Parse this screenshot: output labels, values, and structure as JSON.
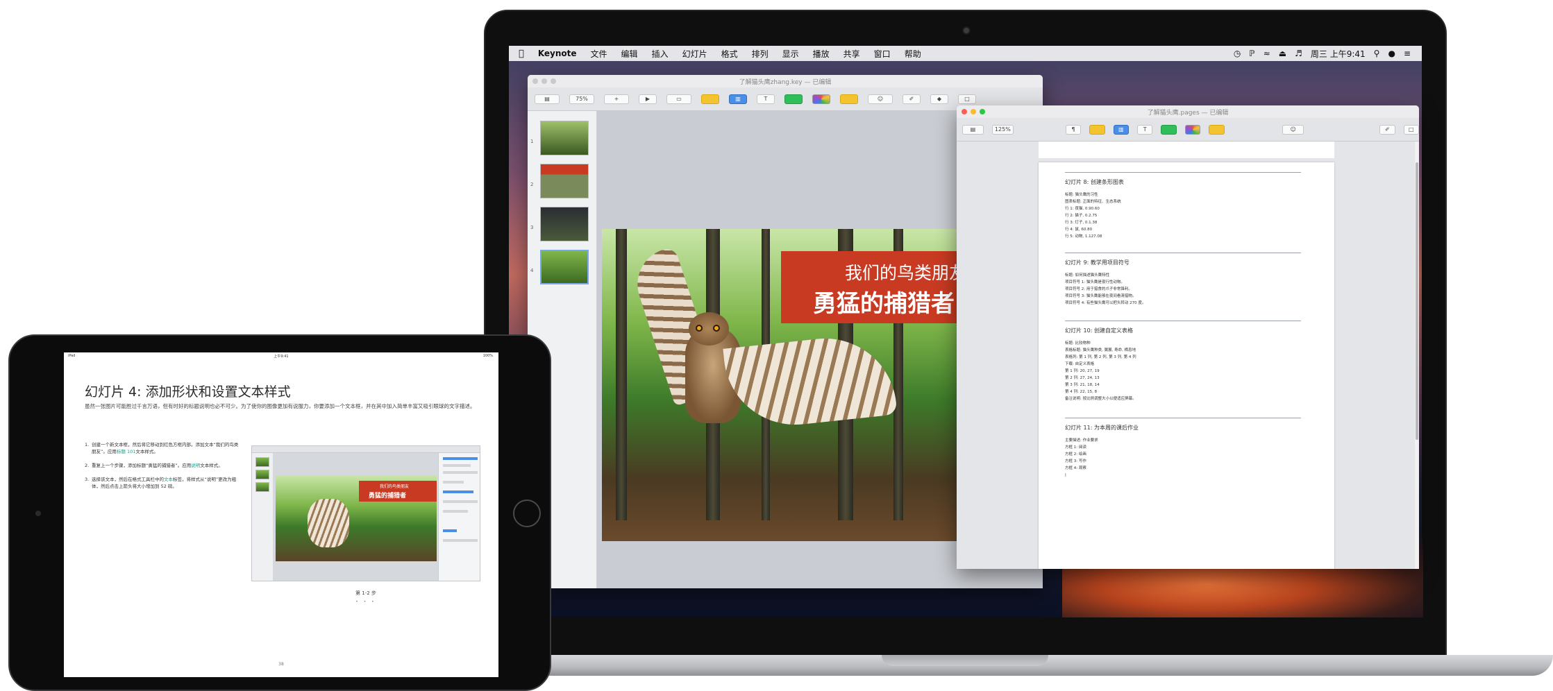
{
  "macbook": {
    "menubar": {
      "apple": "",
      "app_name": "Keynote",
      "menus": [
        "文件",
        "编辑",
        "插入",
        "幻灯片",
        "格式",
        "排列",
        "显示",
        "播放",
        "共享",
        "窗口",
        "帮助"
      ],
      "clock": "周三 上午9:41",
      "status_icons": [
        "time-machine-icon",
        "bluetooth-icon",
        "wifi-icon",
        "eject-icon",
        "volume-icon",
        "spotlight-icon",
        "siri-icon",
        "notification-center-icon"
      ]
    },
    "keynote": {
      "window_title": "了解猫头鹰zhang.key — 已编辑",
      "toolbar": [
        "显示",
        "缩放",
        "添加幻灯片",
        "播放",
        "Keynote Live",
        "表格",
        "图表",
        "文本",
        "形状",
        "媒体",
        "批注",
        "协作",
        "格式",
        "动画",
        "文稿"
      ],
      "zoom": "75%",
      "slide_numbers": [
        "1",
        "2",
        "3",
        "4"
      ],
      "slide": {
        "subtitle": "我们的鸟类朋友",
        "title": "勇猛的捕猎者"
      }
    },
    "pages": {
      "window_title": "了解猫头鹰.pages — 已编辑",
      "zoom": "125%",
      "toolbar": [
        "显示",
        "缩放",
        "插入",
        "表格",
        "图表",
        "文本",
        "形状",
        "媒体",
        "批注",
        "协作",
        "格式",
        "文稿"
      ],
      "sections": [
        {
          "heading": "幻灯片 8: 创建条形图表",
          "lines": [
            "标题: 猫头鹰的习性",
            "图表标题: 正面的特征、生态系统",
            "行 1: 夜猫, 0.90.60",
            "行 2: 猫子, 0.2.75",
            "行 3: 灯子, 0.1.38",
            "行 4: 鼠, 60.80",
            "行 5: 动物, 1.127.08"
          ]
        },
        {
          "heading": "幻灯片 9: 教学用项目符号",
          "lines": [
            "标题: 如何描述猫头鹰特性",
            "项目符号 1: 猫头鹰是夜行性动物。",
            "项目符号 2: 用于猎食的爪子非常锋利。",
            "项目符号 3: 猫头鹰能够在夜间看清猎物。",
            "项目符号 4: 有些猫头鹰可以把头转动 270 度。"
          ]
        },
        {
          "heading": "幻灯片 10: 创建自定义表格",
          "lines": [
            "标题: 比较物种",
            "表格标题: 猫头鹰种类, 翼展, 寿命, 栖息地",
            "表格列: 第 1 列, 第 2 列, 第 3 列, 第 4 列",
            "下载: 自定义表格",
            "第 1 列: 20, 27, 19",
            "第 2 列: 27, 24, 13",
            "第 3 列: 21, 18, 14",
            "第 4 列: 22, 15, 8",
            "备注说明: 按比例调整大小以便适应屏幕。"
          ]
        },
        {
          "heading": "幻灯片 11: 为本周的课后作业",
          "lines": [
            "主要描述: 作业要求",
            "方框 1: 阅读",
            "方框 2: 绘画",
            "方框 3: 写作",
            "方框 4: 观察"
          ]
        }
      ]
    }
  },
  "ipad": {
    "status": {
      "left": "iPad",
      "time": "上午9:41",
      "battery": "100%"
    },
    "title": "幻灯片 4: 添加形状和设置文本样式",
    "description": "虽然一张图片可能胜过千言万语，但有时好的标题说明也必不可少。为了使你的图像更加有说服力，你要添加一个文本框，并在其中加入简单丰富又吸引眼球的文字描述。",
    "steps": [
      {
        "num": "1.",
        "text_before": "创建一个新文本框，然后将它移动到红色方框内部。添加文本“我们的鸟类朋友”。应用",
        "highlight": "标题 101",
        "text_after": "文本样式。"
      },
      {
        "num": "2.",
        "text_before": "重复上一个步骤，添加标题“勇猛的捕猎者”。应用",
        "highlight": "说明",
        "text_after": "文本样式。"
      },
      {
        "num": "3.",
        "text_before": "选择该文本，然后在格式工具栏中的",
        "highlight": "文本",
        "text_after": "标签，将样式从“说明”更改为粗体，然后点击上箭头将大小增加到 52 磅。"
      }
    ],
    "thumbnail": {
      "subtitle": "我们的鸟类朋友",
      "title": "勇猛的捕猎者"
    },
    "caption": "第 1-2 步",
    "page_dots": "• • •",
    "page_number": "38"
  }
}
